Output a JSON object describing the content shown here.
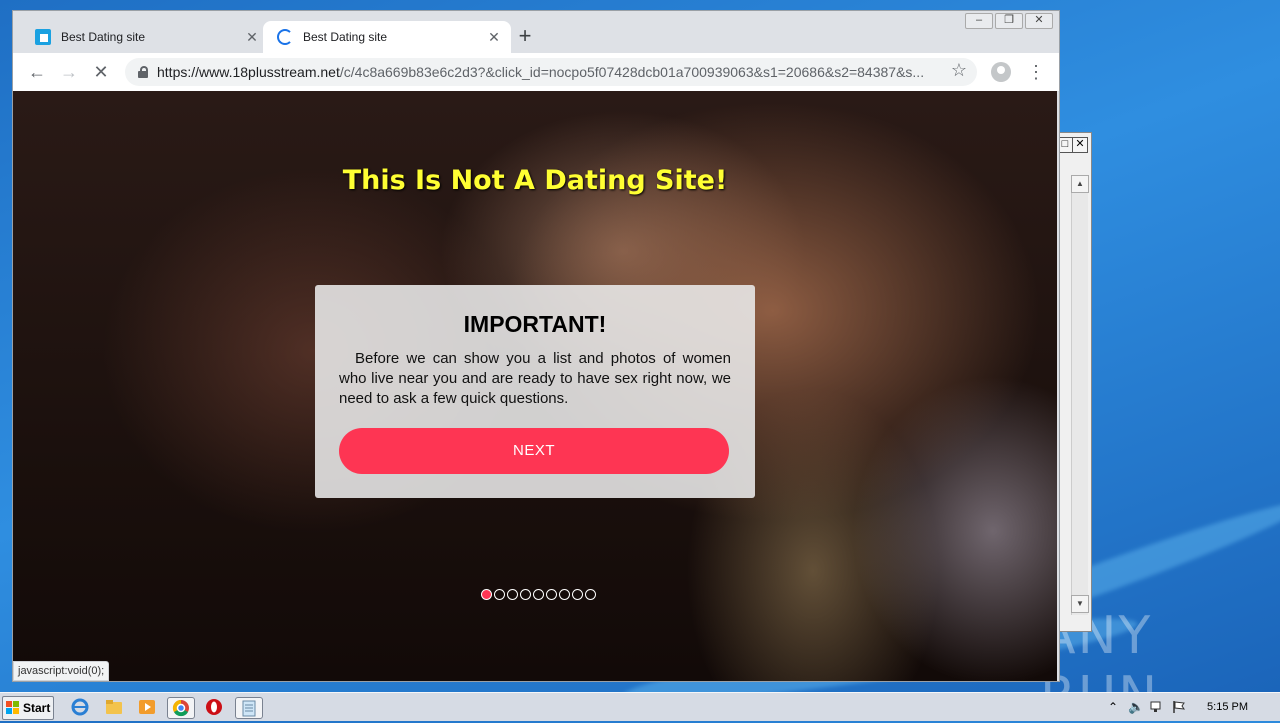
{
  "browser": {
    "tabs": [
      {
        "title": "Best Dating site",
        "state": "inactive"
      },
      {
        "title": "Best Dating site",
        "state": "active-loading"
      }
    ],
    "new_tab_label": "+",
    "url_host": "https://www.18plusstream.net",
    "url_rest": "/c/4c8a669b83e6c2d3?&click_id=nocpo5f07428dcb01a700939063&s1=20686&s2=84387&s...",
    "status_text": "javascript:void(0);"
  },
  "page": {
    "headline": "This Is Not A Dating Site!",
    "modal": {
      "title": "IMPORTANT!",
      "body": "Before we can show you a list and photos of women who live near you and are ready to have sex right now, we need to ask a few quick questions.",
      "button_label": "NEXT"
    },
    "progress": {
      "current_step": 1,
      "total_steps": 9
    }
  },
  "taskbar": {
    "start_label": "Start",
    "clock": "5:15 PM"
  },
  "watermark": "ANY RUN",
  "colors": {
    "accent_button": "#fe3553",
    "headline": "#ffff33",
    "tab_active": "#ffffff",
    "tabstrip": "#dee1e6"
  }
}
